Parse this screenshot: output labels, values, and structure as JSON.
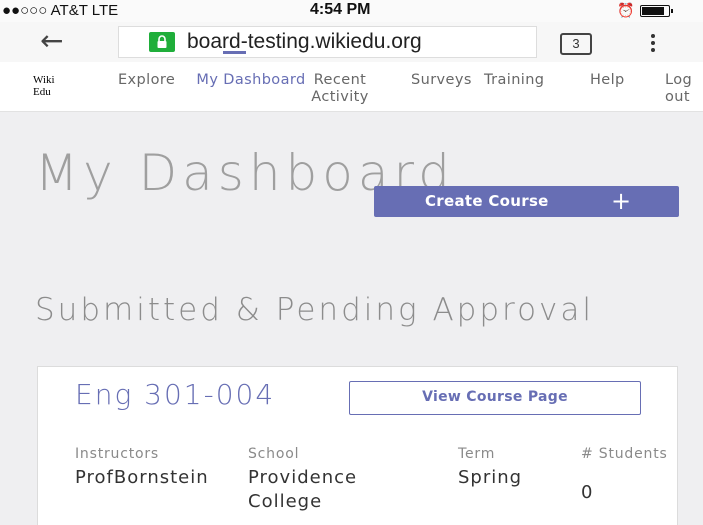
{
  "status_bar": {
    "signal": "●●○○○ AT&T  LTE",
    "time": "4:54 PM",
    "battery_level": 0.8
  },
  "browser": {
    "url": "board-testing.wikiedu.org",
    "url_prefix": " ",
    "tab_count": "3"
  },
  "nav": {
    "logo": "Wiki Edu",
    "items": [
      {
        "label": "Explore"
      },
      {
        "label": "My Dashboard"
      },
      {
        "label": "Recent Activity"
      },
      {
        "label": "Surveys"
      },
      {
        "label": "Training"
      },
      {
        "label": "Help"
      },
      {
        "label": "Log out"
      }
    ]
  },
  "main": {
    "title": "My Dashboard",
    "create_button": "Create Course",
    "section_title": "Submitted & Pending Approval",
    "course": {
      "title": "Eng 301-004",
      "view_button": "View Course Page",
      "labels": {
        "instructors": "Instructors",
        "school": "School",
        "term": "Term",
        "students": "# Students"
      },
      "values": {
        "instructors": "ProfBornstein",
        "school": "Providence College",
        "term": "Spring",
        "students": "0"
      }
    }
  },
  "colors": {
    "accent": "#676eb4",
    "lock_green": "#1fae3a",
    "title_gray": "#9f9f9f"
  }
}
